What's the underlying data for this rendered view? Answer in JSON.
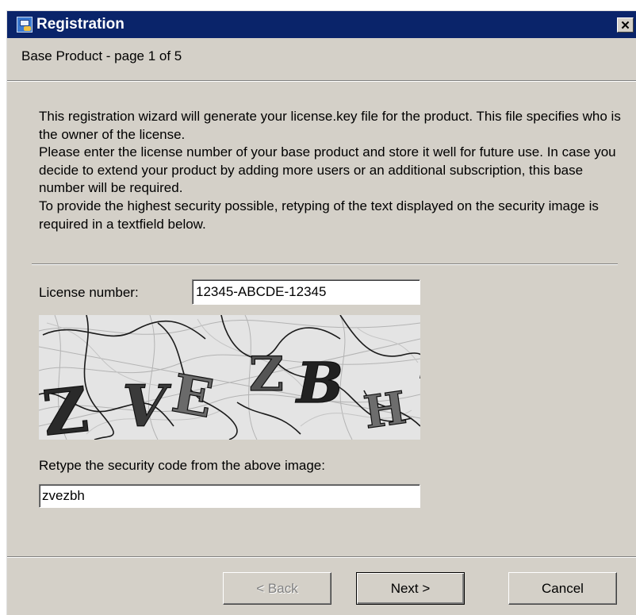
{
  "window": {
    "title": "Registration",
    "close_label": "✕"
  },
  "page": {
    "heading": "Base Product - page 1 of 5"
  },
  "intro": {
    "paragraphs": [
      "This registration wizard will generate your license.key file for the product. This file specifies who is the owner of the license.",
      "Please enter the license number of your base product and store it well for future use. In case you decide to extend your product by adding more users or an additional subscription, this base number will be required.",
      "To provide the highest security possible, retyping of the text displayed on the security image is required in a textfield below."
    ]
  },
  "license": {
    "label": "License number:",
    "value": "12345-ABCDE-12345"
  },
  "captcha": {
    "letters": [
      "Z",
      "V",
      "E",
      "Z",
      "B",
      "H"
    ]
  },
  "security": {
    "label": "Retype the security code from the above image:",
    "value": "zvezbh"
  },
  "buttons": {
    "back": "< Back",
    "next": "Next >",
    "cancel": "Cancel"
  },
  "colors": {
    "titlebar": "#0a246a",
    "dialog_bg": "#d4d0c8",
    "disabled_text": "#808080"
  }
}
